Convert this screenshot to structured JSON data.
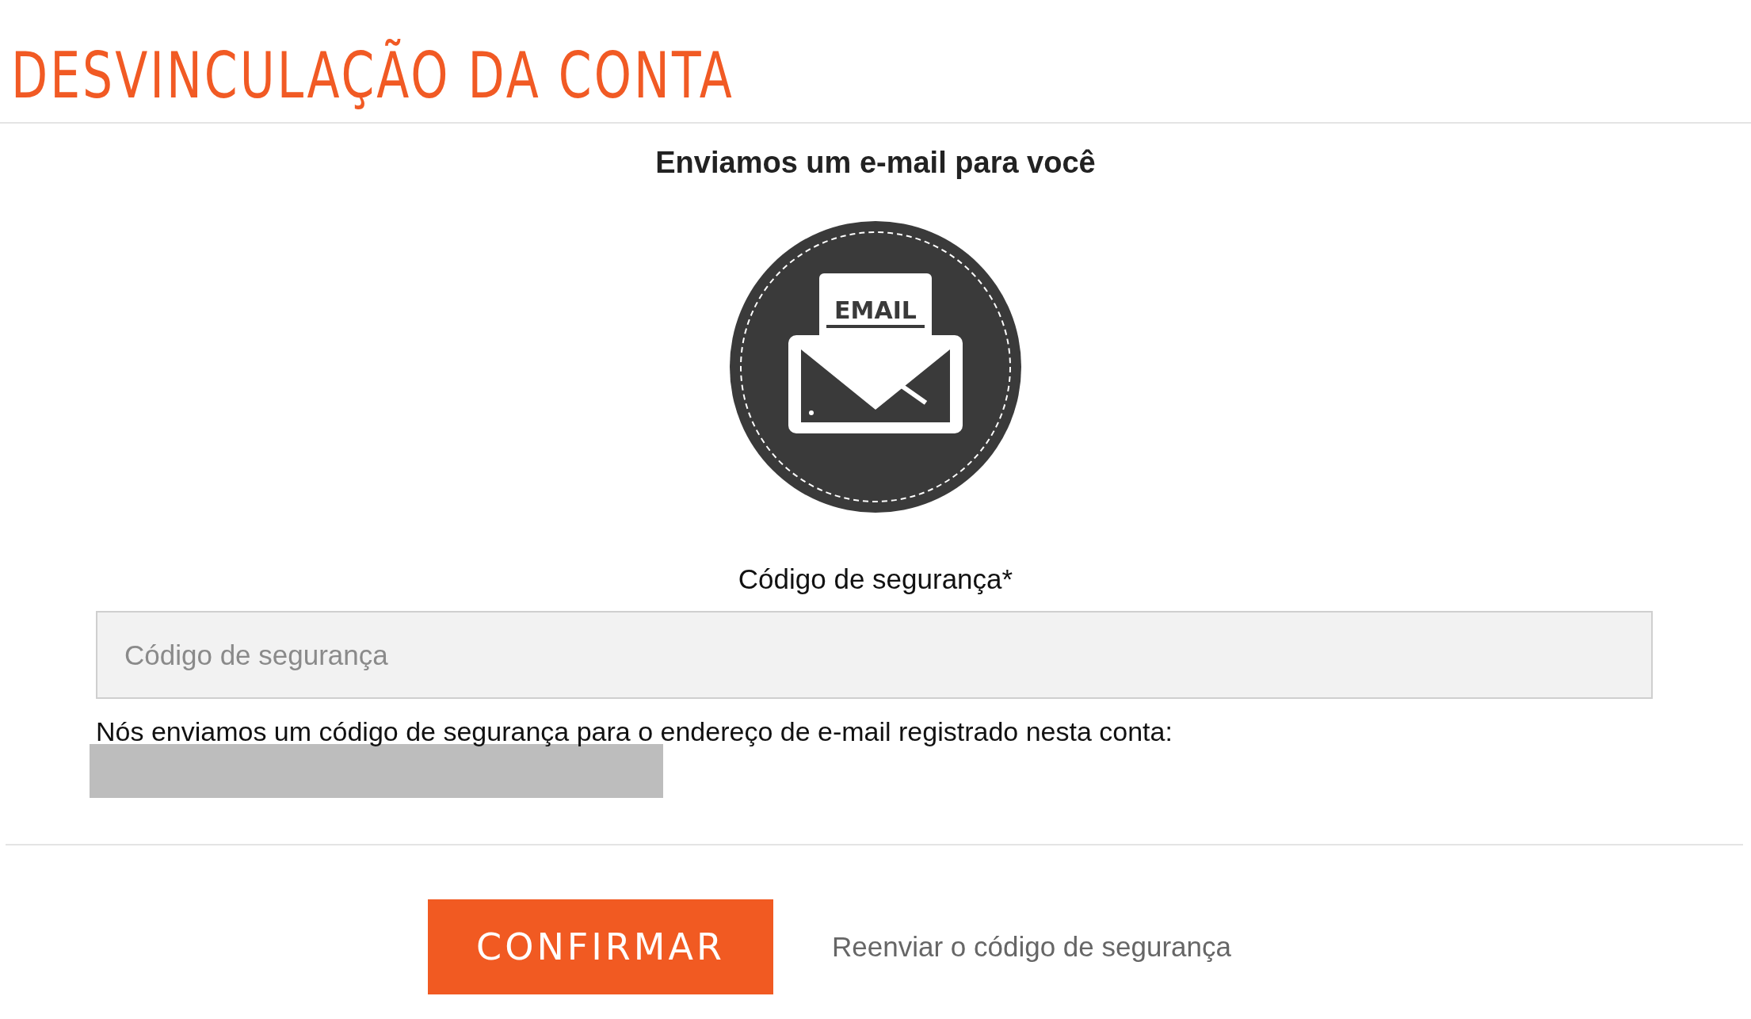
{
  "title": "DESVINCULAÇÃO DA CONTA",
  "heading": "Enviamos um e-mail para você",
  "email_icon": {
    "label": "EMAIL"
  },
  "field": {
    "label": "Código de segurança*",
    "placeholder": "Código de segurança"
  },
  "help_text": "Nós enviamos um código de segurança para o endereço de e-mail registrado nesta conta:",
  "actions": {
    "confirm": "CONFIRMAR",
    "resend": "Reenviar o código de segurança"
  }
}
